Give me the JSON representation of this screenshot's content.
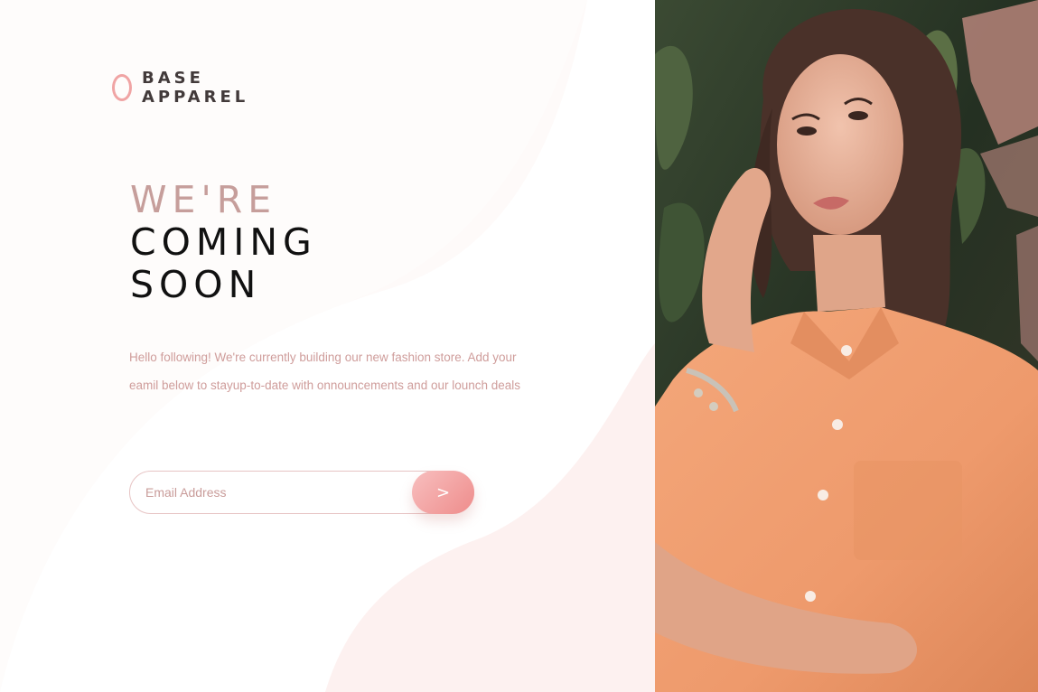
{
  "logo": {
    "line1": "BASE",
    "line2": "APPAREL"
  },
  "hero": {
    "line1": "WE'RE",
    "line2": "COMING",
    "line3": "SOON",
    "description": "Hello following! We're currently building our new fashion store. Add your eamil below to stayup-to-date with onnouncements and our lounch deals"
  },
  "form": {
    "email_placeholder": "Email Address",
    "submit_label": ">"
  },
  "colors": {
    "accent": "#ee8c8b",
    "accent_light": "#f8bfbf",
    "text_muted": "#cf9d9b",
    "heading_light": "#c69e9b",
    "heading_dark": "#111111"
  },
  "hero_image": {
    "icon": "woman-in-peach-shirt-photo"
  }
}
